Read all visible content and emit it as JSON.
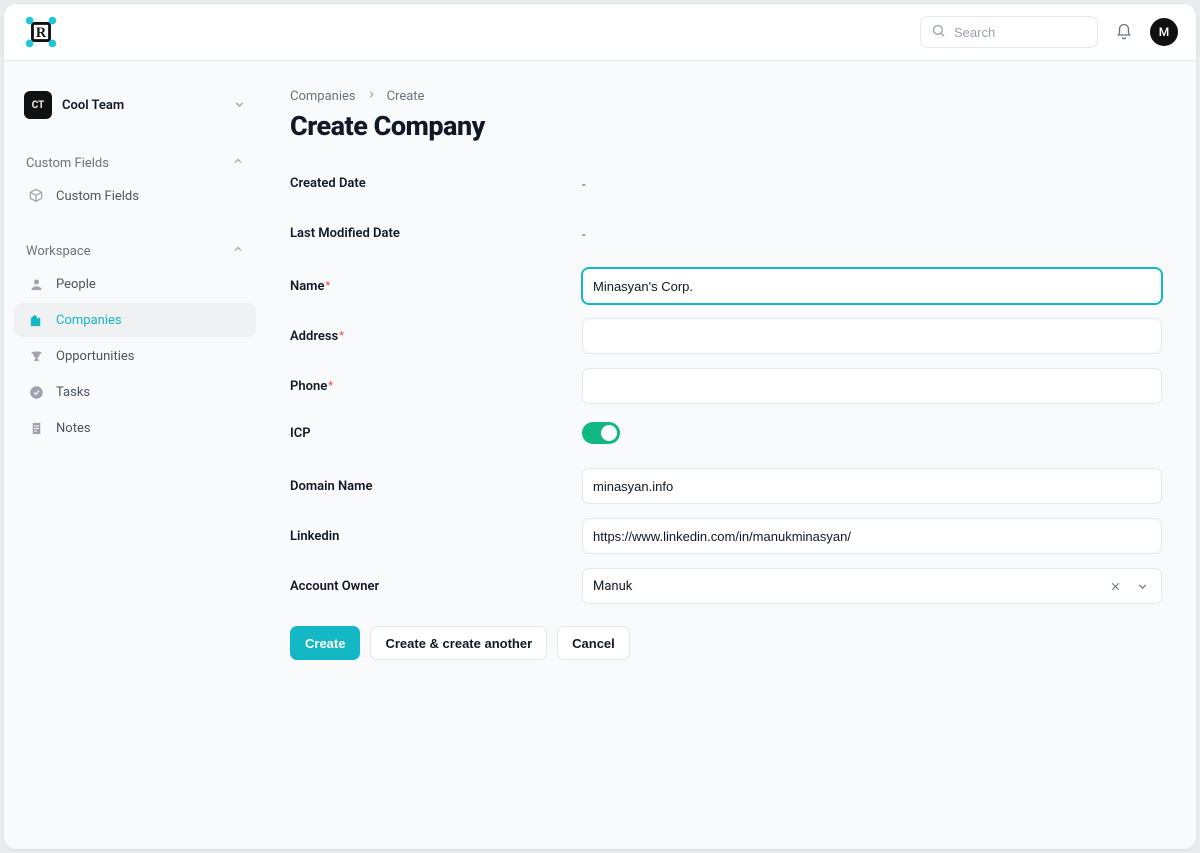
{
  "topbar": {
    "search_placeholder": "Search",
    "avatar_initial": "M"
  },
  "sidebar": {
    "team_initials": "CT",
    "team_name": "Cool Team",
    "section_cf": "Custom Fields",
    "section_ws": "Workspace",
    "items": {
      "custom_fields": "Custom Fields",
      "people": "People",
      "companies": "Companies",
      "opportunities": "Opportunities",
      "tasks": "Tasks",
      "notes": "Notes"
    }
  },
  "breadcrumb": {
    "root": "Companies",
    "leaf": "Create"
  },
  "page_title": "Create Company",
  "form": {
    "created_date_label": "Created Date",
    "created_date_value": "-",
    "lmd_label": "Last Modified Date",
    "lmd_value": "-",
    "name_label": "Name",
    "name_value": "Minasyan's Corp.",
    "address_label": "Address",
    "address_value": "",
    "phone_label": "Phone",
    "phone_value": "",
    "icp_label": "ICP",
    "icp_on": true,
    "domain_label": "Domain Name",
    "domain_value": "minasyan.info",
    "linkedin_label": "Linkedin",
    "linkedin_value": "https://www.linkedin.com/in/manukminasyan/",
    "owner_label": "Account Owner",
    "owner_value": "Manuk"
  },
  "buttons": {
    "create": "Create",
    "create_another": "Create & create another",
    "cancel": "Cancel"
  }
}
